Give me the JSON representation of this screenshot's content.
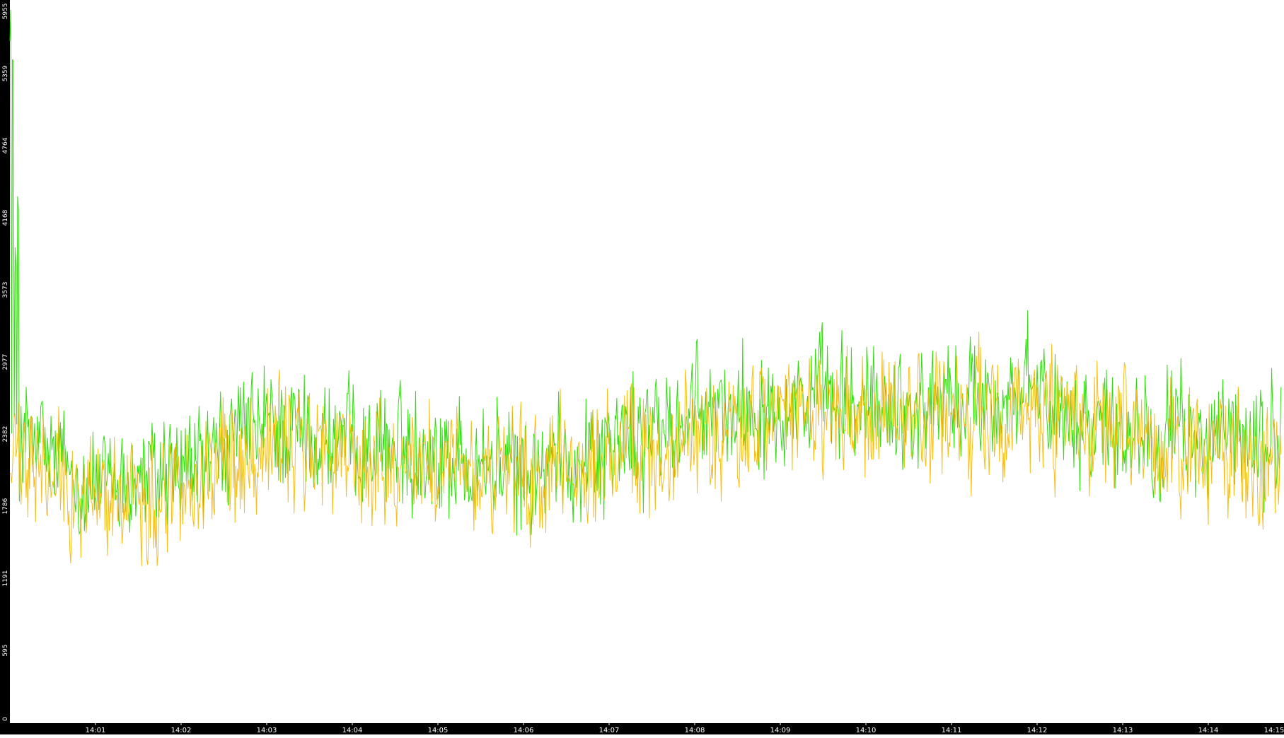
{
  "chart_data": {
    "type": "line",
    "title": "",
    "xlabel": "",
    "ylabel": "",
    "ylim": [
      0,
      5955
    ],
    "xlim_minutes": [
      0,
      15
    ],
    "y_ticks": [
      "0",
      "595",
      "1191",
      "1786",
      "2382",
      "2977",
      "3573",
      "4168",
      "4764",
      "5359",
      "5955"
    ],
    "x_ticks": [
      "14:01",
      "14:02",
      "14:03",
      "14:04",
      "14:05",
      "14:06",
      "14:07",
      "14:08",
      "14:09",
      "14:10",
      "14:11",
      "14:12",
      "14:13",
      "14:14",
      "14:15"
    ],
    "grid": false,
    "legend": "none",
    "series": [
      {
        "color": "#33dd11",
        "points_per_minute": 100,
        "baseline_by_minute": [
          2400,
          1950,
          2050,
          2450,
          2300,
          2250,
          2050,
          2300,
          2500,
          2700,
          2600,
          2650,
          2700,
          2450,
          2350,
          2300
        ],
        "amplitude": 600,
        "initial_spike": [
          5955,
          5500,
          4168,
          4750
        ]
      },
      {
        "color": "#f5b800",
        "points_per_minute": 100,
        "baseline_by_minute": [
          2150,
          1850,
          1950,
          2350,
          2150,
          2100,
          1950,
          2150,
          2350,
          2550,
          2450,
          2500,
          2550,
          2300,
          2200,
          2150
        ],
        "amplitude": 620
      }
    ]
  }
}
